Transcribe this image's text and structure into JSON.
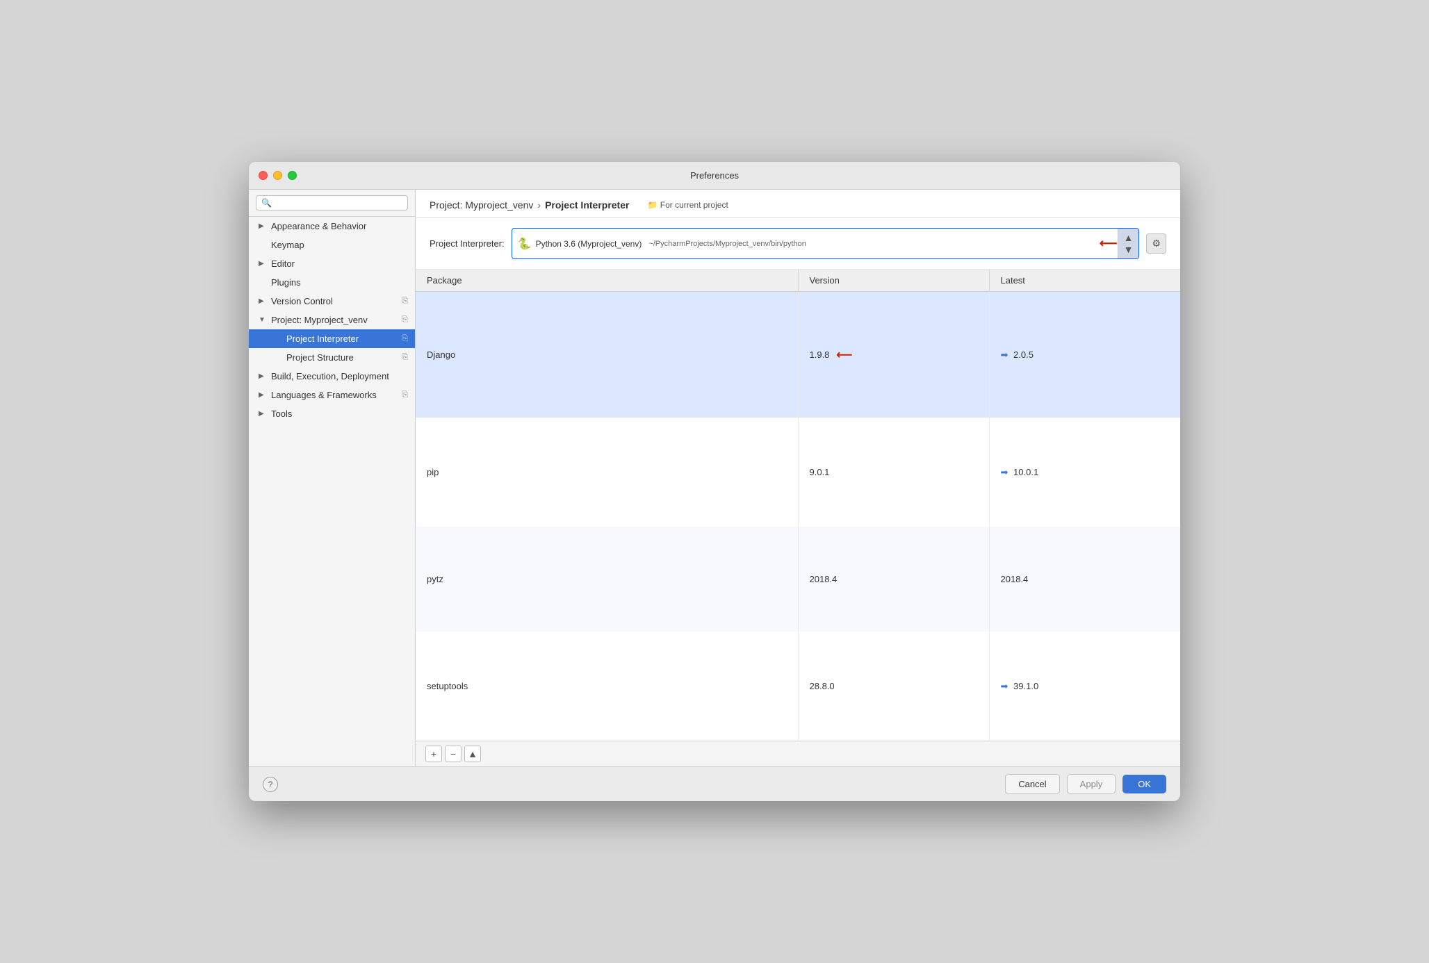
{
  "window": {
    "title": "Preferences"
  },
  "traffic_lights": {
    "close": "close",
    "minimize": "minimize",
    "maximize": "maximize"
  },
  "sidebar": {
    "search_placeholder": "🔍",
    "items": [
      {
        "id": "appearance",
        "label": "Appearance & Behavior",
        "level": "group",
        "chevron": "▶",
        "copy": false
      },
      {
        "id": "keymap",
        "label": "Keymap",
        "level": "top",
        "chevron": "",
        "copy": false
      },
      {
        "id": "editor",
        "label": "Editor",
        "level": "group",
        "chevron": "▶",
        "copy": false
      },
      {
        "id": "plugins",
        "label": "Plugins",
        "level": "top",
        "chevron": "",
        "copy": false
      },
      {
        "id": "version-control",
        "label": "Version Control",
        "level": "group",
        "chevron": "▶",
        "copy": true
      },
      {
        "id": "project",
        "label": "Project: Myproject_venv",
        "level": "group",
        "chevron": "▼",
        "copy": true
      },
      {
        "id": "project-interpreter",
        "label": "Project Interpreter",
        "level": "child",
        "chevron": "",
        "copy": true,
        "active": true
      },
      {
        "id": "project-structure",
        "label": "Project Structure",
        "level": "child",
        "chevron": "",
        "copy": true
      },
      {
        "id": "build",
        "label": "Build, Execution, Deployment",
        "level": "group",
        "chevron": "▶",
        "copy": false
      },
      {
        "id": "languages",
        "label": "Languages & Frameworks",
        "level": "group",
        "chevron": "▶",
        "copy": true
      },
      {
        "id": "tools",
        "label": "Tools",
        "level": "group",
        "chevron": "▶",
        "copy": false
      }
    ]
  },
  "content": {
    "breadcrumb_parent": "Project: Myproject_venv",
    "breadcrumb_sep": "›",
    "breadcrumb_current": "Project Interpreter",
    "for_current": "For current project",
    "interpreter_label": "Project Interpreter:",
    "interpreter_icon": "🐍",
    "interpreter_name": "Python 3.6 (Myproject_venv)",
    "interpreter_path": "~/PycharmProjects/Myproject_venv/bin/python",
    "packages_table": {
      "headers": [
        "Package",
        "Version",
        "Latest"
      ],
      "rows": [
        {
          "package": "Django",
          "version": "1.9.8",
          "latest": "2.0.5",
          "has_upgrade": true,
          "selected": true
        },
        {
          "package": "pip",
          "version": "9.0.1",
          "latest": "10.0.1",
          "has_upgrade": true,
          "selected": false
        },
        {
          "package": "pytz",
          "version": "2018.4",
          "latest": "2018.4",
          "has_upgrade": false,
          "selected": false
        },
        {
          "package": "setuptools",
          "version": "28.8.0",
          "latest": "39.1.0",
          "has_upgrade": true,
          "selected": false
        }
      ]
    },
    "toolbar": {
      "add": "+",
      "remove": "−",
      "upgrade": "▲"
    }
  },
  "bottom_bar": {
    "help": "?",
    "cancel": "Cancel",
    "apply": "Apply",
    "ok": "OK"
  }
}
